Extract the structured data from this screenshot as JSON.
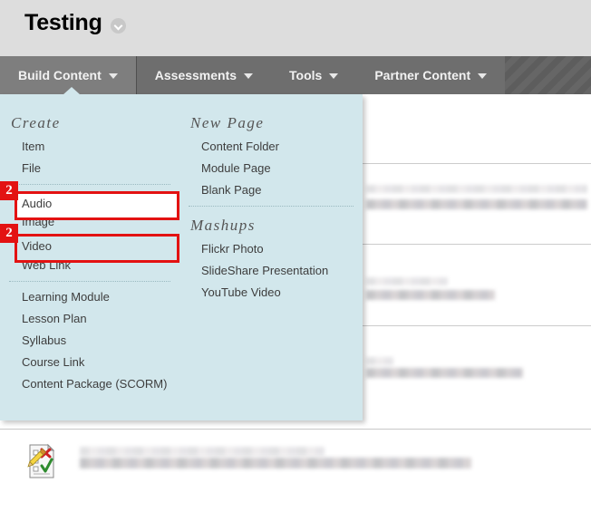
{
  "header": {
    "title": "Testing",
    "title_menu_icon": "chevron-down-circle-icon"
  },
  "action_bar": {
    "items": [
      {
        "label": "Build Content",
        "icon": "chevron-down-icon",
        "active": true
      },
      {
        "label": "Assessments",
        "icon": "chevron-down-icon",
        "active": false
      },
      {
        "label": "Tools",
        "icon": "chevron-down-icon",
        "active": false
      },
      {
        "label": "Partner Content",
        "icon": "chevron-down-icon",
        "active": false
      }
    ]
  },
  "dropdown": {
    "left_column": {
      "heading": "Create",
      "items": [
        {
          "label": "Item"
        },
        {
          "label": "File"
        },
        {
          "label": "Audio"
        },
        {
          "label": "Image"
        },
        {
          "label": "Video"
        },
        {
          "label": "Web Link"
        },
        {
          "label": "Learning Module"
        },
        {
          "label": "Lesson Plan"
        },
        {
          "label": "Syllabus"
        },
        {
          "label": "Course Link"
        },
        {
          "label": "Content Package (SCORM)"
        }
      ]
    },
    "right_column": {
      "heading_new_page": "New Page",
      "new_page_items": [
        {
          "label": "Content Folder"
        },
        {
          "label": "Module Page"
        },
        {
          "label": "Blank Page"
        }
      ],
      "heading_mashups": "Mashups",
      "mashup_items": [
        {
          "label": "Flickr Photo"
        },
        {
          "label": "SlideShare Presentation"
        },
        {
          "label": "YouTube Video"
        }
      ]
    }
  },
  "annotations": {
    "accent_color": "#e31212",
    "highlights": [
      {
        "badge": "2",
        "target": "Audio"
      },
      {
        "badge": "2",
        "target": "Video"
      }
    ]
  },
  "content": {
    "rows": [
      {
        "redacted": true
      },
      {
        "redacted": true
      },
      {
        "redacted": true
      }
    ],
    "bottom_item": {
      "icon": "test-quiz-icon",
      "redacted_title": true
    }
  },
  "colors": {
    "page_header_bg": "#dddddd",
    "action_bar_bg": "#606060",
    "menu_strip_bg": "#6e6e6e",
    "active_tab_bg": "#7e7e7e",
    "dropdown_bg": "#d2e7ec",
    "accent_red": "#e31212"
  }
}
